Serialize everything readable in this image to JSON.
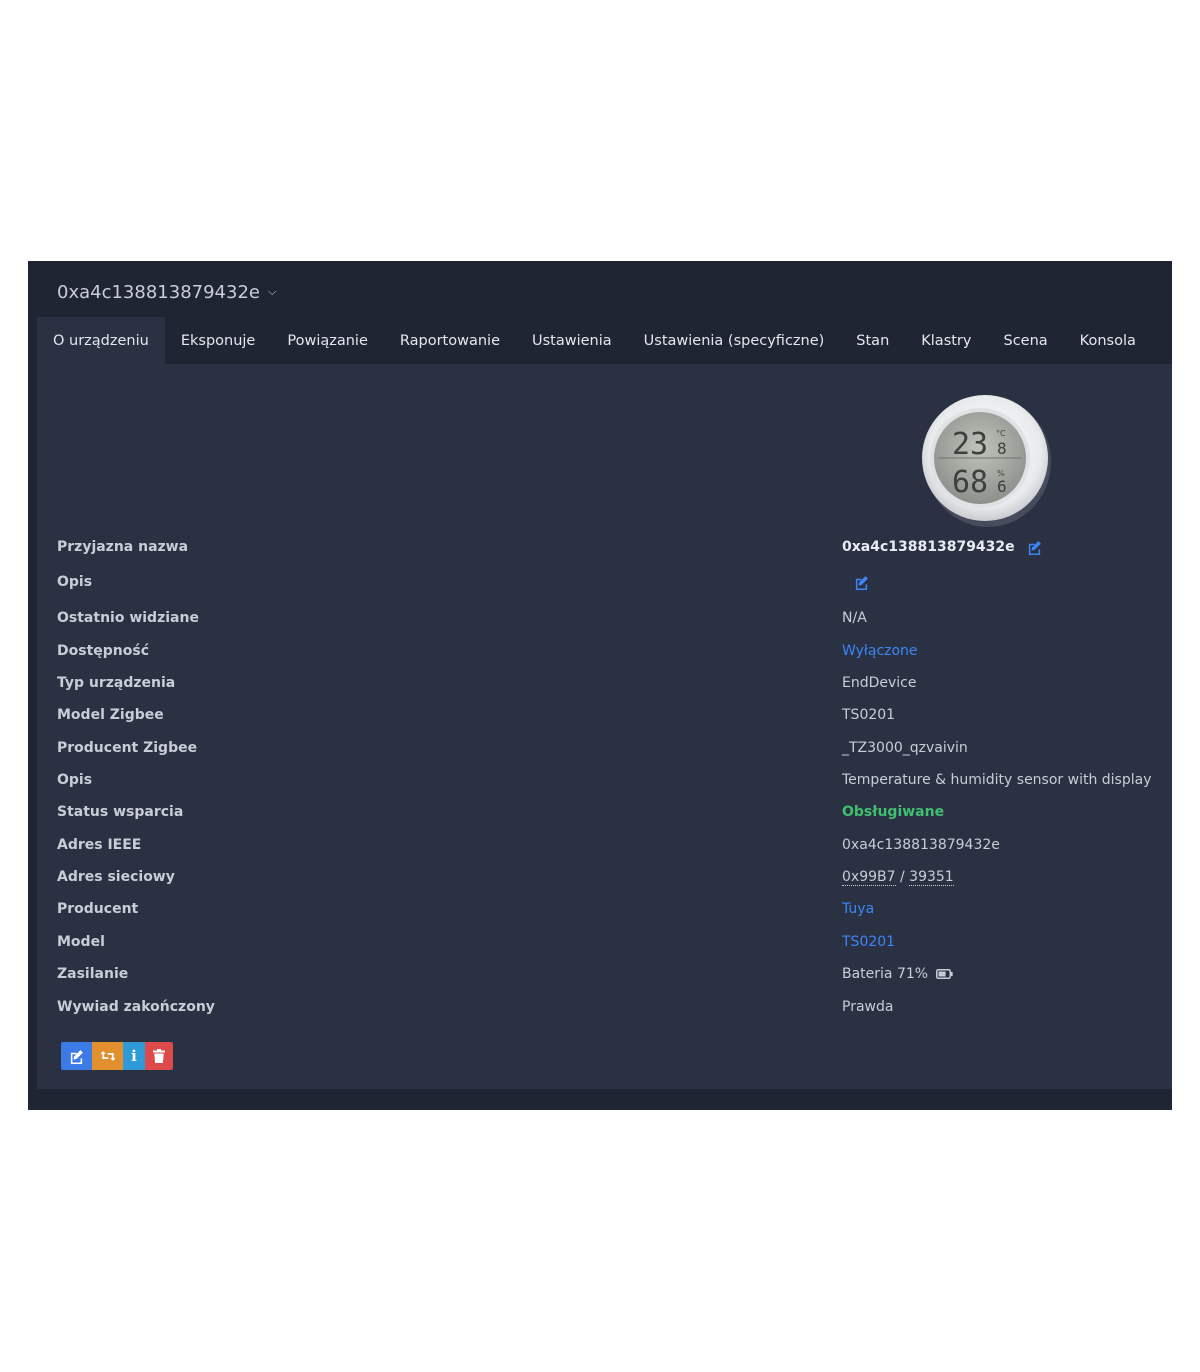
{
  "device": {
    "title": "0xa4c138813879432e"
  },
  "tabs": [
    {
      "label": "O urządzeniu",
      "active": true
    },
    {
      "label": "Eksponuje"
    },
    {
      "label": "Powiązanie"
    },
    {
      "label": "Raportowanie"
    },
    {
      "label": "Ustawienia"
    },
    {
      "label": "Ustawienia (specyficzne)"
    },
    {
      "label": "Stan"
    },
    {
      "label": "Klastry"
    },
    {
      "label": "Scena"
    },
    {
      "label": "Konsola"
    }
  ],
  "lcd": {
    "temp_main": "23",
    "temp_dec": "8",
    "hum_main": "68",
    "hum_dec": "6",
    "temp_unit": "°C",
    "hum_unit": "%"
  },
  "info": {
    "friendly_name_label": "Przyjazna nazwa",
    "friendly_name": "0xa4c138813879432e",
    "description_label": "Opis",
    "last_seen_label": "Ostatnio widziane",
    "last_seen": "N/A",
    "availability_label": "Dostępność",
    "availability": "Wyłączone",
    "device_type_label": "Typ urządzenia",
    "device_type": "EndDevice",
    "zigbee_model_label": "Model Zigbee",
    "zigbee_model": "TS0201",
    "zigbee_manufacturer_label": "Producent Zigbee",
    "zigbee_manufacturer": "_TZ3000_qzvaivin",
    "model_description_label": "Opis",
    "model_description": "Temperature & humidity sensor with display",
    "support_status_label": "Status wsparcia",
    "support_status": "Obsługiwane",
    "ieee_label": "Adres IEEE",
    "ieee": "0xa4c138813879432e",
    "network_address_label": "Adres sieciowy",
    "network_hex": "0x99B7",
    "network_sep": " / ",
    "network_dec": "39351",
    "vendor_label": "Producent",
    "vendor": "Tuya",
    "model_label": "Model",
    "model": "TS0201",
    "power_label": "Zasilanie",
    "power": "Bateria 71%",
    "battery_level": 0.71,
    "interview_label": "Wywiad zakończony",
    "interview": "Prawda"
  },
  "actions": {
    "info_glyph": "i"
  },
  "colors": {
    "link": "#3d86f5",
    "supported": "#3fbf6f",
    "background": "#1f2532",
    "panel": "#2a3142"
  }
}
